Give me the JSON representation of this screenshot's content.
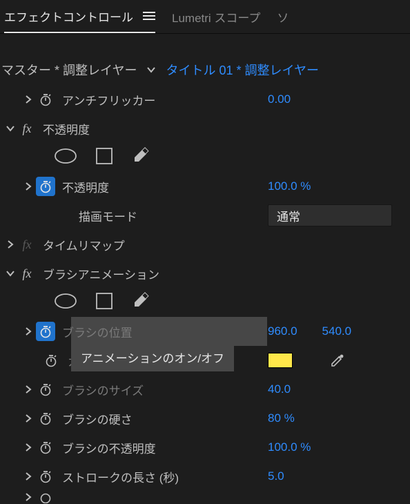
{
  "tabs": {
    "effect_controls": "エフェクトコントロール",
    "lumetri_scopes": "Lumetri スコープ",
    "source_truncated": "ソ"
  },
  "master": {
    "prefix": "マスター * 調整レイヤー",
    "clip": "タイトル 01 * 調整レイヤー"
  },
  "props": {
    "anti_flicker": {
      "label": "アンチフリッカー",
      "value": "0.00"
    },
    "opacity_group": "不透明度",
    "opacity": {
      "label": "不透明度",
      "value": "100.0 %"
    },
    "blend_mode": {
      "label": "描画モード",
      "value": "通常"
    },
    "time_remap": "タイムリマップ",
    "brush_anim": "ブラシアニメーション",
    "brush_position": {
      "label": "ブラシの位置",
      "x": "960.0",
      "y": "540.0"
    },
    "color": {
      "label": "カラー",
      "swatch": "#ffe74a"
    },
    "brush_size": {
      "label": "ブラシのサイズ",
      "value": "40.0"
    },
    "brush_hardness": {
      "label": "ブラシの硬さ",
      "value": "80 %"
    },
    "brush_opacity": {
      "label": "ブラシの不透明度",
      "value": "100.0 %"
    },
    "stroke_length": {
      "label": "ストロークの長さ (秒)",
      "value": "5.0"
    }
  },
  "tooltip": "アニメーションのオン/オフ",
  "icons": {
    "menu": "menu-icon",
    "chevron_right": "chevron-right",
    "chevron_down": "chevron-down",
    "stopwatch": "stopwatch",
    "ellipse": "ellipse-mask",
    "rect": "rect-mask",
    "pen": "pen-mask",
    "eyedropper": "eyedropper"
  }
}
